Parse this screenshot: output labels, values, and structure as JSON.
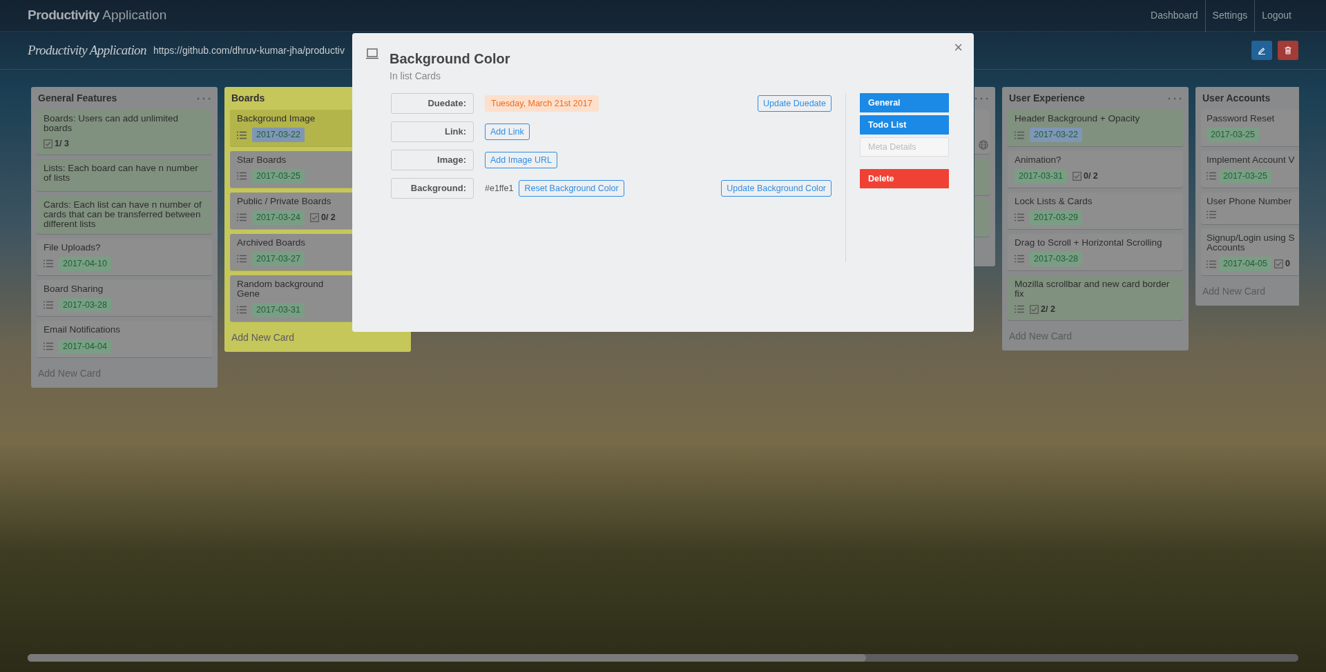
{
  "navbar": {
    "brand_bold": "Productivity",
    "brand_light": "Application",
    "links": [
      "Dashboard",
      "Settings",
      "Logout"
    ]
  },
  "board": {
    "title": "Productivity Application",
    "url": "https://github.com/dhruv-kumar-jha/productiv"
  },
  "lists": [
    {
      "kind": "full",
      "title": "General Features",
      "color": "#888a8b",
      "menu": true,
      "add_label": "Add New Card",
      "cards": [
        {
          "title": "Boards: Users can add unlimited boards",
          "color": "#80917f",
          "description": false,
          "checklist": "1/ 3"
        },
        {
          "title": "Lists: Each board can have n number of lists",
          "color": "#80917f",
          "description": false
        },
        {
          "title": "Cards: Each list can have n number of cards that can be transferred between different lists",
          "color": "#80917f",
          "description": false
        },
        {
          "title": "File Uploads?",
          "color": "#8e8e8e",
          "description": true,
          "due": {
            "text": "2017-04-10",
            "color": "#7a9e84"
          }
        },
        {
          "title": "Board Sharing",
          "color": "#8e8e8e",
          "description": true,
          "due": {
            "text": "2017-03-28",
            "color": "#7a9e84"
          }
        },
        {
          "title": "Email Notifications",
          "color": "#8e8e8e",
          "description": true,
          "due": {
            "text": "2017-04-04",
            "color": "#7a9e84"
          }
        }
      ]
    },
    {
      "kind": "full",
      "title": "Boards",
      "color": "#c6c75b",
      "menu": false,
      "add_label": "Add New Card",
      "cards": [
        {
          "title": "Background Image",
          "color": "#b3b44a",
          "description": true,
          "due": {
            "text": "2017-03-22",
            "color": "#7f96b5"
          }
        },
        {
          "title": "Star Boards",
          "color": "#8e8e8e",
          "description": true,
          "due": {
            "text": "2017-03-25",
            "color": "#7a9e84"
          }
        },
        {
          "title": "Public / Private Boards",
          "color": "#8e8e8e",
          "description": true,
          "due": {
            "text": "2017-03-24",
            "color": "#7a9e84"
          },
          "checklist": "0/ 2"
        },
        {
          "title": "Archived Boards",
          "color": "#8e8e8e",
          "description": true,
          "due": {
            "text": "2017-03-27",
            "color": "#7a9e84"
          }
        },
        {
          "title": "Random background Gene",
          "color": "#8e8e8e",
          "description": true,
          "due": {
            "text": "2017-03-31",
            "color": "#7a9e84"
          }
        }
      ]
    },
    {
      "kind": "covered",
      "color": "#888a8b",
      "menu": true,
      "cards": [
        {
          "color": "#8e8e8e",
          "link": true
        },
        {
          "color": "#80917f"
        },
        {
          "color": "#80917f"
        }
      ]
    },
    {
      "kind": "full",
      "title": "User Experience",
      "color": "#888a8b",
      "menu": true,
      "add_label": "Add New Card",
      "cards": [
        {
          "title": "Header Background + Opacity",
          "color": "#80917f",
          "description": true,
          "due": {
            "text": "2017-03-22",
            "color": "#7f96b5"
          }
        },
        {
          "title": "Animation?",
          "color": "#8e8e8e",
          "description": false,
          "due": {
            "text": "2017-03-31",
            "color": "#7a9e84"
          },
          "checklist": "0/ 2"
        },
        {
          "title": "Lock Lists & Cards",
          "color": "#8e8e8e",
          "description": true,
          "due": {
            "text": "2017-03-29",
            "color": "#7a9e84"
          }
        },
        {
          "title": "Drag to Scroll + Horizontal Scrolling",
          "color": "#8e8e8e",
          "description": true,
          "due": {
            "text": "2017-03-28",
            "color": "#7a9e84"
          }
        },
        {
          "title": "Mozilla scrollbar and new card border fix",
          "color": "#80917f",
          "description": true,
          "checklist": "2/ 2"
        }
      ]
    },
    {
      "kind": "cut",
      "title": "User Accounts",
      "color": "#888a8b",
      "menu": false,
      "add_label": "Add New Card",
      "cards": [
        {
          "title": "Password Reset",
          "color": "#8e8e8e",
          "description": false,
          "due": {
            "text": "2017-03-25",
            "color": "#7a9e84"
          }
        },
        {
          "title": "Implement Account V",
          "color": "#8e8e8e",
          "description": true,
          "due": {
            "text": "2017-03-25",
            "color": "#7a9e84"
          }
        },
        {
          "title": "User Phone Number",
          "color": "#8e8e8e",
          "description": true
        },
        {
          "title": "Signup/Login using S Accounts",
          "color": "#8e8e8e",
          "description": true,
          "due": {
            "text": "2017-04-05",
            "color": "#7a9e84"
          },
          "checklist": "0"
        }
      ]
    }
  ],
  "modal": {
    "close": "×",
    "title": "Background Color",
    "subtitle": "In list",
    "list_link": "Cards",
    "fields": [
      {
        "kind": "date",
        "label": "Duedate:",
        "value": "Tuesday, March 21st 2017",
        "action": "Update Duedate"
      },
      {
        "kind": "button",
        "label": "Link:",
        "button": "Add Link"
      },
      {
        "kind": "button",
        "label": "Image:",
        "button": "Add Image URL"
      },
      {
        "kind": "color",
        "label": "Background:",
        "value": "#e1ffe1",
        "button": "Reset Background Color",
        "action": "Update Background Color"
      }
    ],
    "side_buttons": [
      {
        "label": "General",
        "kind": "primary",
        "disabled": false
      },
      {
        "label": "Todo List",
        "kind": "primary",
        "disabled": false
      },
      {
        "label": "Meta Details",
        "kind": "light",
        "disabled": true
      },
      {
        "label": "Delete",
        "kind": "danger",
        "disabled": false
      }
    ]
  }
}
